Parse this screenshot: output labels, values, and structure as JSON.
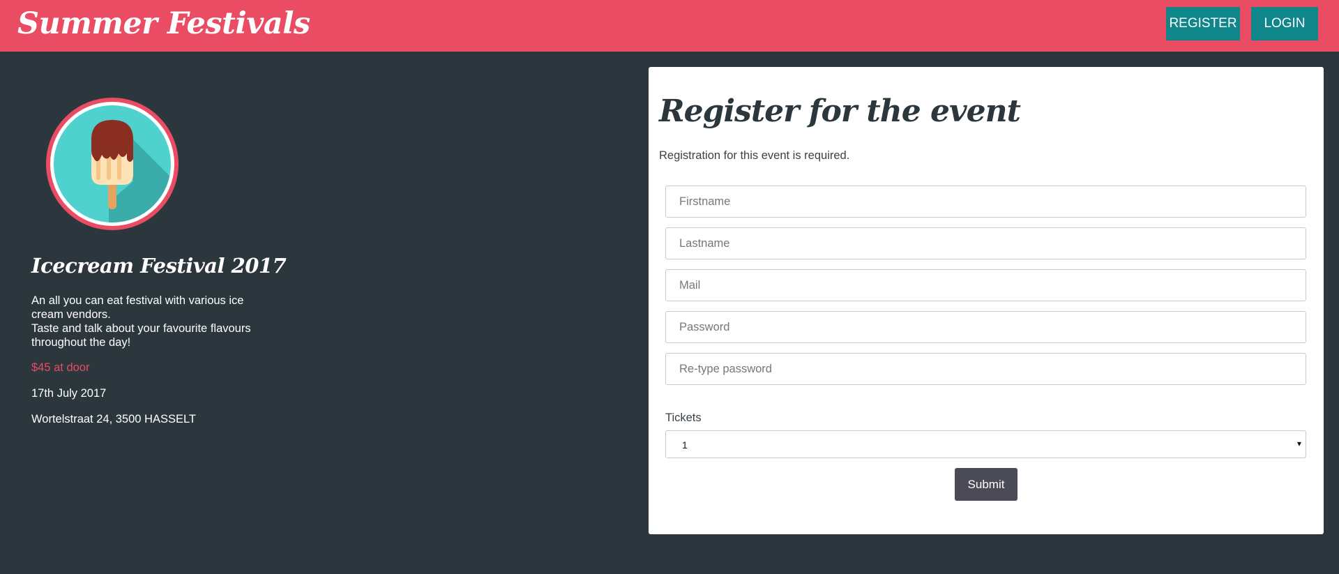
{
  "header": {
    "brand": "Summer Festivals",
    "register_label": "REGISTER",
    "login_label": "LOGIN"
  },
  "event": {
    "logo_icon": "popsicle-icon",
    "title": "Icecream Festival 2017",
    "description_line1": "An all you can eat festival with various ice cream vendors.",
    "description_line2": "Taste and talk about your favourite flavours throughout the day!",
    "price": "$45 at door",
    "date": "17th July 2017",
    "address": "Wortelstraat 24, 3500 HASSELT"
  },
  "form": {
    "title": "Register for the event",
    "subtitle": "Registration for this event is required.",
    "firstname_placeholder": "Firstname",
    "lastname_placeholder": "Lastname",
    "mail_placeholder": "Mail",
    "password_placeholder": "Password",
    "repassword_placeholder": "Re-type password",
    "tickets_label": "Tickets",
    "tickets_value": "1",
    "tickets_arrow": "▾",
    "submit_label": "Submit"
  },
  "colors": {
    "header_bg": "#e94c63",
    "page_bg": "#2b363d",
    "nav_button_bg": "#0f878a",
    "price_text": "#e94c63",
    "submit_bg": "#4b4b57"
  }
}
